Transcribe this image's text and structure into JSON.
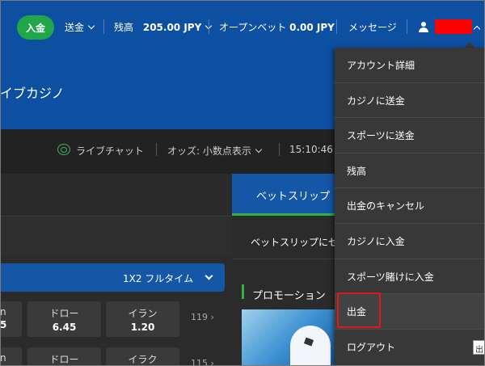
{
  "topbar": {
    "deposit_label": "入金",
    "transfer_label": "送金",
    "balance_label": "残高",
    "balance_value": "205.00 JPY",
    "open_bet_label": "オープンベット",
    "open_bet_value": "0.00 JPY",
    "messages_label": "メッセージ"
  },
  "page_title": "イブカジノ",
  "subbar": {
    "live_chat_label": "ライブチャット",
    "odds_label": "オッズ: 小数点表示",
    "time": "15:10:46"
  },
  "betslip": {
    "tab_label": "ベットスリップ",
    "message": "ベットスリップにセ"
  },
  "market": {
    "label": "1X2 フルタイム"
  },
  "matches": [
    {
      "home_label": "n",
      "home_value": "5",
      "draw_label": "ドロー",
      "draw_value": "6.45",
      "away_label": "イラン",
      "away_value": "1.20",
      "more": "119"
    },
    {
      "home_label": "n",
      "home_value": "",
      "draw_label": "ドロー",
      "draw_value": "",
      "away_label": "イラク",
      "away_value": "",
      "more": "115"
    }
  ],
  "promotion": {
    "title": "プロモーション"
  },
  "dropdown": {
    "items": [
      "アカウント詳細",
      "カジノに送金",
      "スポーツに送金",
      "残高",
      "出金のキャンセル",
      "カジノに入金",
      "スポーツ賭けに入金",
      "出金",
      "ログアウト"
    ],
    "highlighted_index": 7
  },
  "tooltip_text": "出",
  "colors": {
    "header_blue": "#0d4fa0",
    "accent_green": "#22a64a",
    "highlight_red": "#e01818"
  }
}
